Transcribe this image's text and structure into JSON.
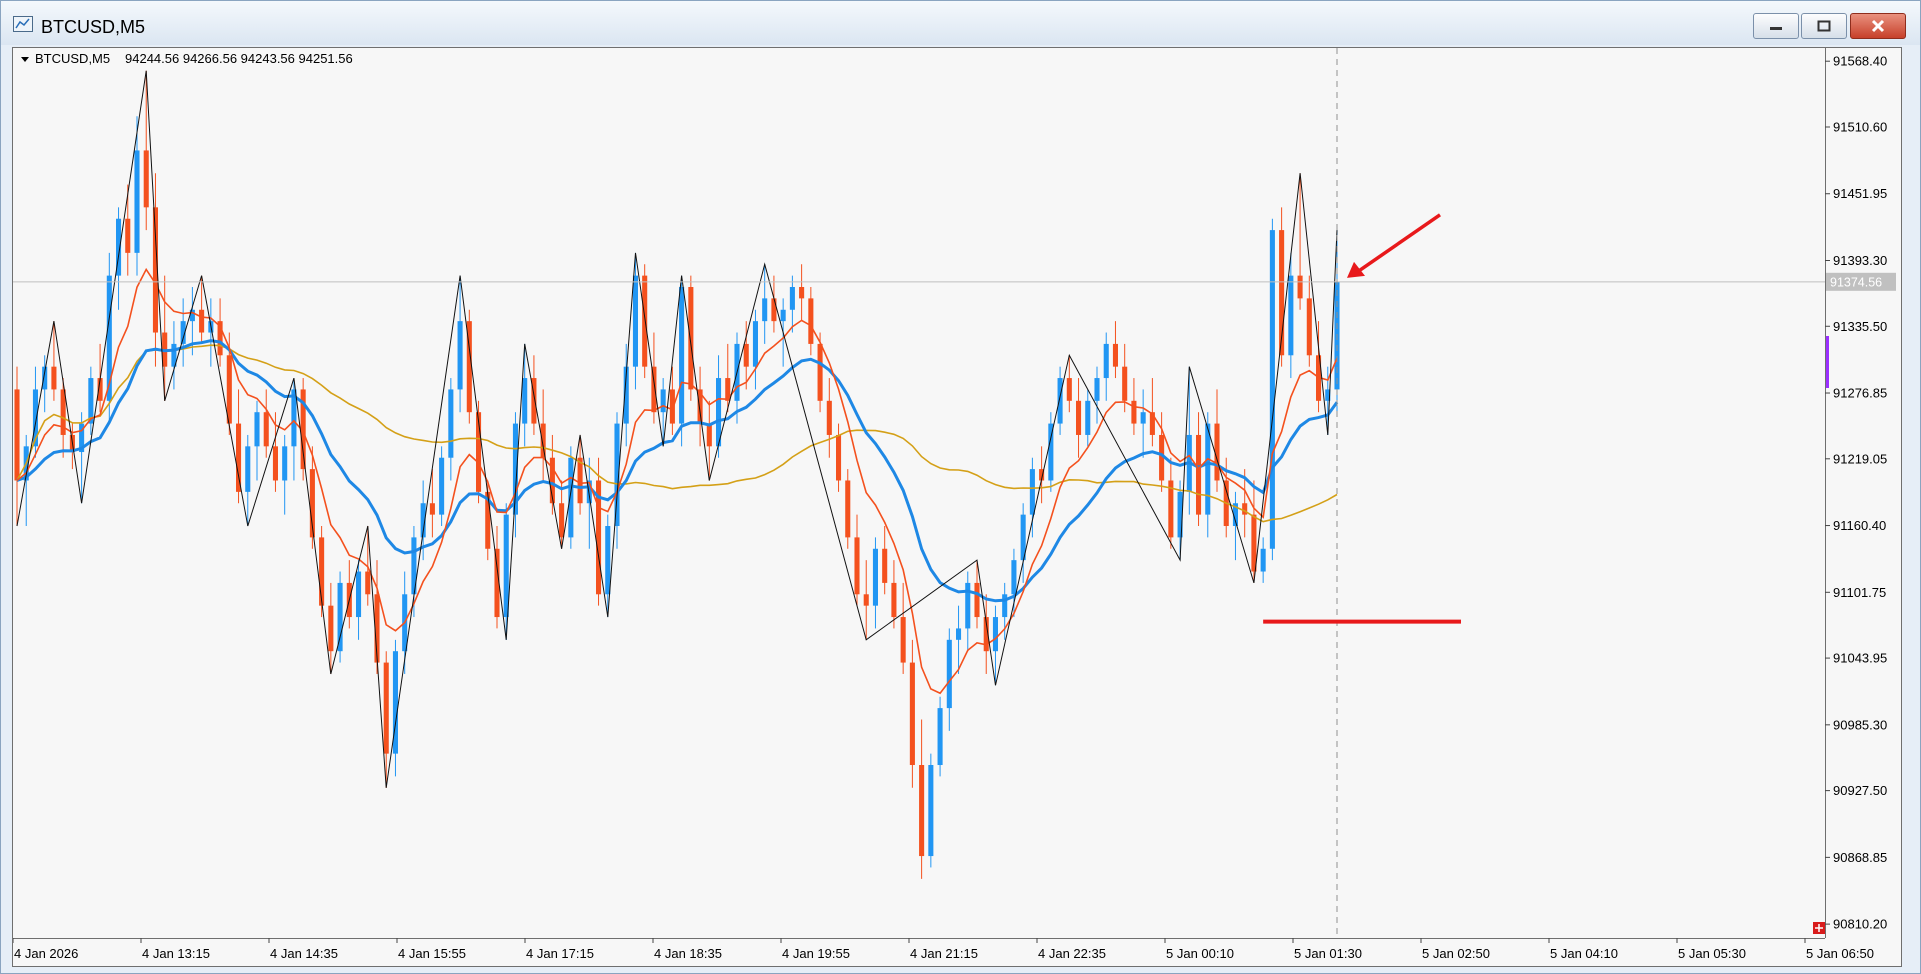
{
  "window": {
    "title": "BTCUSD,M5",
    "buttons": [
      "minimize-icon",
      "maximize-icon",
      "close-icon"
    ]
  },
  "chart_data": {
    "type": "candlestick",
    "symbol": "BTCUSD,M5",
    "ohlc_label": "94244.56 94266.56 94243.56 94251.56",
    "current_price_label": "91374.56",
    "current_price": 91374.56,
    "y_ticks": [
      "91568.40",
      "91510.60",
      "91451.95",
      "91393.30",
      "91335.50",
      "91276.85",
      "91219.05",
      "91160.40",
      "91101.75",
      "91043.95",
      "90985.30",
      "90927.50",
      "90868.85",
      "90810.20"
    ],
    "ylim": [
      90798,
      91580
    ],
    "x_ticks": [
      "4 Jan 2026",
      "4 Jan 13:15",
      "4 Jan 14:35",
      "4 Jan 15:55",
      "4 Jan 17:15",
      "4 Jan 18:35",
      "4 Jan 19:55",
      "4 Jan 21:15",
      "4 Jan 22:35",
      "5 Jan 00:10",
      "5 Jan 01:30",
      "5 Jan 02:50",
      "5 Jan 04:10",
      "5 Jan 05:30",
      "5 Jan 06:50"
    ],
    "candles": [
      [
        91280,
        91300,
        91160,
        91200
      ],
      [
        91200,
        91240,
        91160,
        91230
      ],
      [
        91230,
        91300,
        91220,
        91280
      ],
      [
        91280,
        91310,
        91260,
        91300
      ],
      [
        91300,
        91340,
        91270,
        91280
      ],
      [
        91280,
        91290,
        91220,
        91240
      ],
      [
        91240,
        91250,
        91210,
        91225
      ],
      [
        91225,
        91260,
        91180,
        91250
      ],
      [
        91250,
        91300,
        91240,
        91290
      ],
      [
        91290,
        91320,
        91260,
        91270
      ],
      [
        91270,
        91400,
        91250,
        91380
      ],
      [
        91380,
        91440,
        91350,
        91430
      ],
      [
        91430,
        91460,
        91380,
        91400
      ],
      [
        91400,
        91520,
        91380,
        91490
      ],
      [
        91490,
        91560,
        91420,
        91440
      ],
      [
        91440,
        91470,
        91300,
        91330
      ],
      [
        91330,
        91380,
        91270,
        91300
      ],
      [
        91300,
        91340,
        91280,
        91320
      ],
      [
        91320,
        91360,
        91300,
        91340
      ],
      [
        91340,
        91370,
        91310,
        91350
      ],
      [
        91350,
        91380,
        91320,
        91330
      ],
      [
        91330,
        91360,
        91300,
        91340
      ],
      [
        91340,
        91360,
        91300,
        91310
      ],
      [
        91310,
        91330,
        91240,
        91250
      ],
      [
        91250,
        91280,
        91180,
        91190
      ],
      [
        91190,
        91240,
        91160,
        91230
      ],
      [
        91230,
        91270,
        91200,
        91260
      ],
      [
        91260,
        91280,
        91220,
        91230
      ],
      [
        91230,
        91260,
        91190,
        91200
      ],
      [
        91200,
        91240,
        91170,
        91230
      ],
      [
        91230,
        91290,
        91200,
        91280
      ],
      [
        91280,
        91290,
        91200,
        91210
      ],
      [
        91210,
        91230,
        91140,
        91150
      ],
      [
        91150,
        91160,
        91080,
        91090
      ],
      [
        91090,
        91110,
        91030,
        91050
      ],
      [
        91050,
        91120,
        91040,
        91110
      ],
      [
        91110,
        91130,
        91070,
        91080
      ],
      [
        91080,
        91130,
        91060,
        91120
      ],
      [
        91120,
        91160,
        91090,
        91100
      ],
      [
        91100,
        91130,
        91030,
        91040
      ],
      [
        91040,
        91050,
        90930,
        90960
      ],
      [
        90960,
        91060,
        90940,
        91050
      ],
      [
        91050,
        91120,
        91030,
        91100
      ],
      [
        91100,
        91160,
        91080,
        91150
      ],
      [
        91150,
        91200,
        91130,
        91180
      ],
      [
        91180,
        91210,
        91150,
        91170
      ],
      [
        91170,
        91230,
        91160,
        91220
      ],
      [
        91220,
        91290,
        91200,
        91280
      ],
      [
        91280,
        91380,
        91260,
        91340
      ],
      [
        91340,
        91350,
        91250,
        91260
      ],
      [
        91260,
        91270,
        91180,
        91190
      ],
      [
        91190,
        91200,
        91130,
        91140
      ],
      [
        91140,
        91160,
        91070,
        91080
      ],
      [
        91080,
        91180,
        91060,
        91170
      ],
      [
        91170,
        91260,
        91150,
        91250
      ],
      [
        91250,
        91320,
        91230,
        91290
      ],
      [
        91290,
        91310,
        91240,
        91250
      ],
      [
        91250,
        91280,
        91200,
        91220
      ],
      [
        91220,
        91240,
        91170,
        91180
      ],
      [
        91180,
        91200,
        91140,
        91150
      ],
      [
        91150,
        91230,
        91140,
        91220
      ],
      [
        91220,
        91240,
        91170,
        91180
      ],
      [
        91180,
        91220,
        91140,
        91200
      ],
      [
        91200,
        91220,
        91090,
        91100
      ],
      [
        91100,
        91170,
        91080,
        91160
      ],
      [
        91160,
        91260,
        91140,
        91250
      ],
      [
        91250,
        91320,
        91230,
        91300
      ],
      [
        91300,
        91400,
        91280,
        91380
      ],
      [
        91380,
        91390,
        91290,
        91300
      ],
      [
        91300,
        91330,
        91250,
        91260
      ],
      [
        91260,
        91290,
        91230,
        91280
      ],
      [
        91280,
        91300,
        91240,
        91250
      ],
      [
        91250,
        91380,
        91230,
        91370
      ],
      [
        91370,
        91380,
        91270,
        91280
      ],
      [
        91280,
        91300,
        91230,
        91250
      ],
      [
        91250,
        91270,
        91200,
        91230
      ],
      [
        91230,
        91310,
        91220,
        91290
      ],
      [
        91290,
        91320,
        91260,
        91270
      ],
      [
        91270,
        91330,
        91250,
        91320
      ],
      [
        91320,
        91340,
        91280,
        91300
      ],
      [
        91300,
        91350,
        91280,
        91340
      ],
      [
        91340,
        91390,
        91320,
        91360
      ],
      [
        91360,
        91380,
        91330,
        91340
      ],
      [
        91340,
        91360,
        91300,
        91350
      ],
      [
        91350,
        91380,
        91330,
        91370
      ],
      [
        91370,
        91390,
        91340,
        91360
      ],
      [
        91360,
        91370,
        91310,
        91320
      ],
      [
        91320,
        91330,
        91260,
        91270
      ],
      [
        91270,
        91290,
        91220,
        91240
      ],
      [
        91240,
        91250,
        91190,
        91200
      ],
      [
        91200,
        91210,
        91140,
        91150
      ],
      [
        91150,
        91170,
        91090,
        91100
      ],
      [
        91100,
        91130,
        91060,
        91090
      ],
      [
        91090,
        91150,
        91070,
        91140
      ],
      [
        91140,
        91160,
        91100,
        91110
      ],
      [
        91110,
        91130,
        91070,
        91080
      ],
      [
        91080,
        91110,
        91030,
        91040
      ],
      [
        91040,
        91060,
        90930,
        90950
      ],
      [
        90950,
        90990,
        90850,
        90870
      ],
      [
        90870,
        90960,
        90860,
        90950
      ],
      [
        90950,
        91010,
        90940,
        91000
      ],
      [
        91000,
        91070,
        90980,
        91060
      ],
      [
        91060,
        91090,
        91030,
        91070
      ],
      [
        91070,
        91120,
        91050,
        91110
      ],
      [
        91110,
        91130,
        91070,
        91080
      ],
      [
        91080,
        91100,
        91030,
        91050
      ],
      [
        91050,
        91090,
        91020,
        91080
      ],
      [
        91080,
        91110,
        91060,
        91100
      ],
      [
        91100,
        91140,
        91080,
        91130
      ],
      [
        91130,
        91180,
        91110,
        91170
      ],
      [
        91170,
        91220,
        91150,
        91210
      ],
      [
        91210,
        91230,
        91180,
        91200
      ],
      [
        91200,
        91260,
        91190,
        91250
      ],
      [
        91250,
        91300,
        91240,
        91290
      ],
      [
        91290,
        91310,
        91260,
        91270
      ],
      [
        91270,
        91290,
        91220,
        91240
      ],
      [
        91240,
        91280,
        91230,
        91270
      ],
      [
        91270,
        91300,
        91250,
        91290
      ],
      [
        91290,
        91330,
        91270,
        91320
      ],
      [
        91320,
        91340,
        91290,
        91300
      ],
      [
        91300,
        91320,
        91260,
        91270
      ],
      [
        91270,
        91290,
        91240,
        91250
      ],
      [
        91250,
        91280,
        91220,
        91260
      ],
      [
        91260,
        91290,
        91230,
        91240
      ],
      [
        91240,
        91260,
        91190,
        91200
      ],
      [
        91200,
        91220,
        91140,
        91150
      ],
      [
        91150,
        91200,
        91130,
        91190
      ],
      [
        91190,
        91300,
        91170,
        91240
      ],
      [
        91240,
        91260,
        91160,
        91170
      ],
      [
        91170,
        91260,
        91150,
        91250
      ],
      [
        91250,
        91280,
        91190,
        91200
      ],
      [
        91200,
        91220,
        91150,
        91160
      ],
      [
        91160,
        91190,
        91130,
        91180
      ],
      [
        91180,
        91210,
        91150,
        91170
      ],
      [
        91170,
        91200,
        91110,
        91120
      ],
      [
        91120,
        91150,
        91110,
        91140
      ],
      [
        91140,
        91430,
        91130,
        91420
      ],
      [
        91420,
        91440,
        91300,
        91310
      ],
      [
        91310,
        91400,
        91290,
        91380
      ],
      [
        91380,
        91470,
        91350,
        91360
      ],
      [
        91360,
        91380,
        91300,
        91310
      ],
      [
        91310,
        91340,
        91260,
        91270
      ],
      [
        91270,
        91300,
        91240,
        91280
      ],
      [
        91280,
        91420,
        91260,
        91374.56
      ]
    ],
    "overlays": [
      {
        "label": "blue-ma-line",
        "color": "#1e88e5"
      },
      {
        "label": "red-ma-line",
        "color": "#f4511e"
      },
      {
        "label": "gold-ma-line",
        "color": "#d4a017"
      },
      {
        "label": "zigzag-line",
        "color": "#111111"
      }
    ],
    "annotations": {
      "support_level": 91076,
      "arrow_color": "#e8191b"
    },
    "colors": {
      "bull": "#2196f3",
      "bear": "#f4511e",
      "background": "#f7f7f7",
      "grid": "#c8c8c8"
    }
  }
}
